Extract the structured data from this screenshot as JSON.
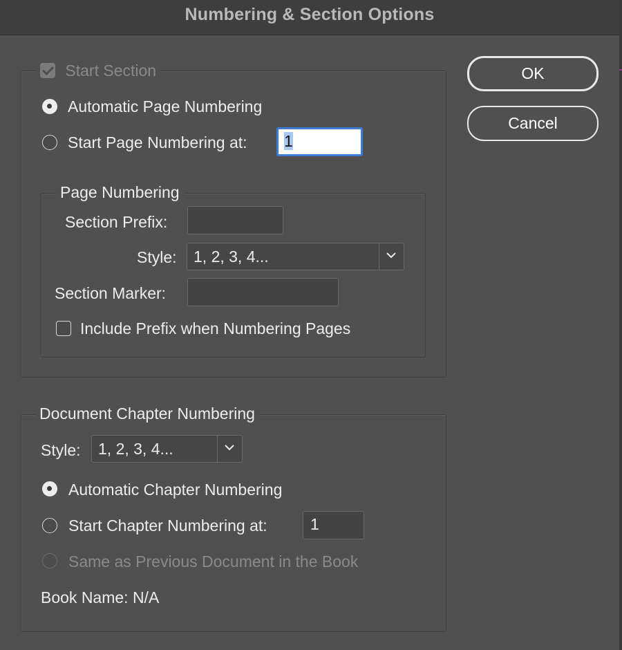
{
  "window": {
    "title": "Numbering & Section Options"
  },
  "buttons": {
    "ok": "OK",
    "cancel": "Cancel"
  },
  "start_section": {
    "label": "Start Section",
    "checked": true,
    "automatic_page_numbering": "Automatic Page Numbering",
    "start_page_numbering_at": "Start Page Numbering at:",
    "start_page_value": "1",
    "page_numbering": {
      "legend": "Page Numbering",
      "section_prefix_label": "Section Prefix:",
      "section_prefix_value": "",
      "style_label": "Style:",
      "style_value": "1, 2, 3, 4...",
      "section_marker_label": "Section Marker:",
      "section_marker_value": "",
      "include_prefix_label": "Include Prefix when Numbering Pages"
    }
  },
  "chapter": {
    "legend": "Document Chapter Numbering",
    "style_label": "Style:",
    "style_value": "1, 2, 3, 4...",
    "automatic_chapter_numbering": "Automatic Chapter Numbering",
    "start_chapter_numbering_at": "Start Chapter Numbering at:",
    "start_chapter_value": "1",
    "same_as_previous": "Same as Previous Document in the Book",
    "book_name": "Book Name: N/A"
  },
  "icons": {
    "dropdown": "chevron-down-icon",
    "checkmark": "checkmark-icon"
  }
}
